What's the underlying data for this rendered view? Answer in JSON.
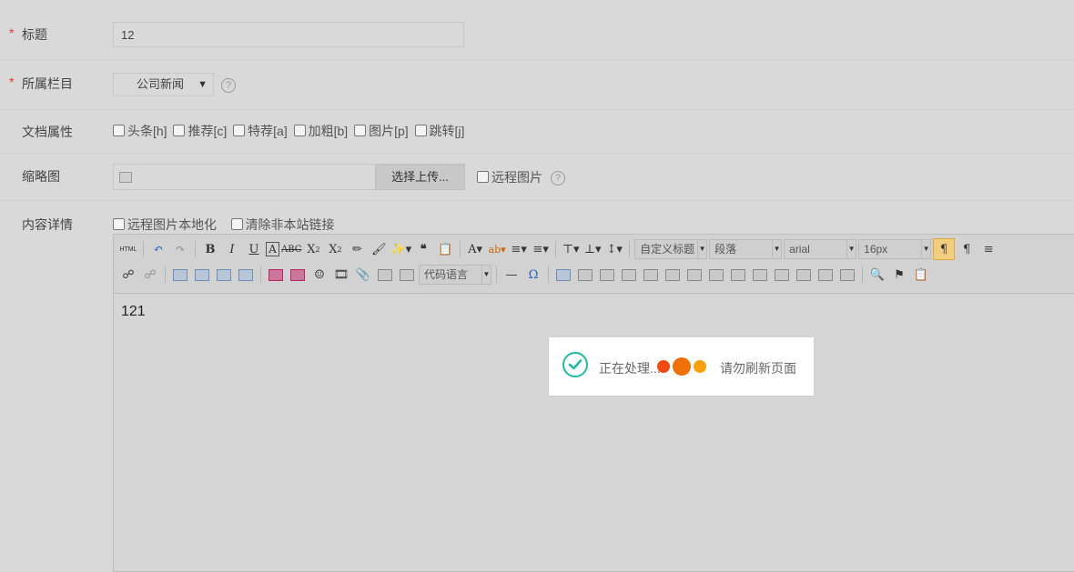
{
  "form": {
    "title": {
      "required_mark": "*",
      "label": "标题",
      "value": "12"
    },
    "column": {
      "required_mark": "*",
      "label": "所属栏目",
      "selected": "公司新闻",
      "help": "?"
    },
    "attributes": {
      "label": "文档属性",
      "options": [
        "头条[h]",
        "推荐[c]",
        "特荐[a]",
        "加粗[b]",
        "图片[p]",
        "跳转[j]"
      ]
    },
    "thumbnail": {
      "label": "缩略图",
      "upload_label": "选择上传...",
      "remote_label": "远程图片",
      "help": "?"
    },
    "content": {
      "label": "内容详情",
      "opt_localize": "远程图片本地化",
      "opt_clear_links": "清除非本站链接"
    }
  },
  "editor": {
    "toolbar": {
      "html": "HTML",
      "heading_select": "自定义标题",
      "paragraph_select": "段落",
      "font_select": "arial",
      "size_select": "16px",
      "code_select": "代码语言"
    },
    "body_text": "121"
  },
  "toast": {
    "message": "正在处理...",
    "hint": "请勿刷新页面",
    "dot_colors": [
      "#f04a12",
      "#f07008",
      "#f5a00c"
    ]
  },
  "colors": {
    "required": "#e03a3a",
    "check": "#24b8a6",
    "background": "#d9d9d9"
  }
}
